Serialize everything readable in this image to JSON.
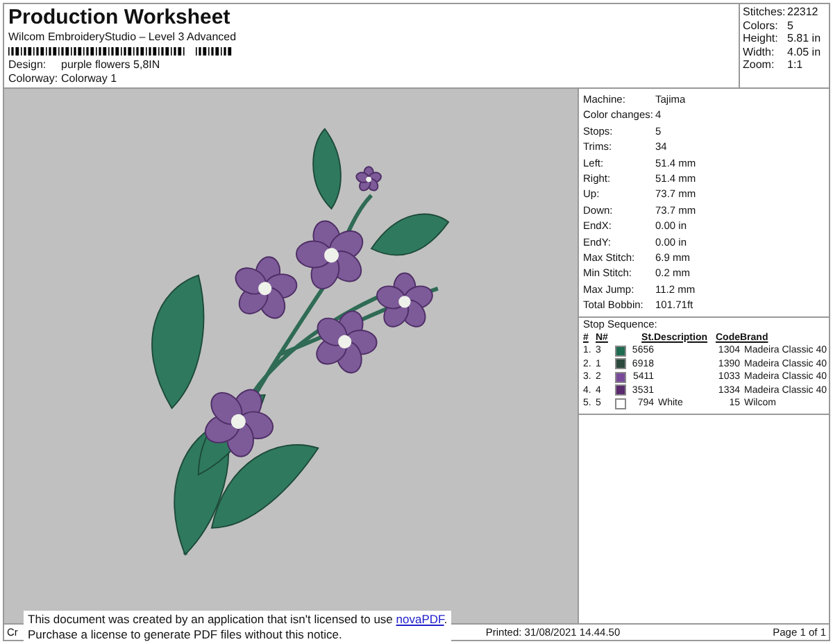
{
  "header": {
    "title": "Production Worksheet",
    "subtitle": "Wilcom EmbroideryStudio – Level 3 Advanced",
    "fields": [
      {
        "label": "Design:",
        "value": "purple flowers 5,8IN"
      },
      {
        "label": "Colorway:",
        "value": "Colorway 1"
      }
    ]
  },
  "summary": [
    {
      "label": "Stitches:",
      "value": "22312"
    },
    {
      "label": "Colors:",
      "value": "5"
    },
    {
      "label": "Height:",
      "value": "5.81 in"
    },
    {
      "label": "Width:",
      "value": "4.05 in"
    },
    {
      "label": "Zoom:",
      "value": "1:1"
    }
  ],
  "machine_info": [
    {
      "label": "Machine:",
      "value": "Tajima"
    },
    {
      "label": "Color changes:",
      "value": "4"
    },
    {
      "label": "Stops:",
      "value": "5"
    },
    {
      "label": "Trims:",
      "value": "34"
    },
    {
      "label": "Left:",
      "value": "51.4 mm"
    },
    {
      "label": "Right:",
      "value": "51.4 mm"
    },
    {
      "label": "Up:",
      "value": "73.7 mm"
    },
    {
      "label": "Down:",
      "value": "73.7 mm"
    },
    {
      "label": "EndX:",
      "value": "0.00 in"
    },
    {
      "label": "EndY:",
      "value": "0.00 in"
    },
    {
      "label": "Max Stitch:",
      "value": "6.9 mm"
    },
    {
      "label": "Min Stitch:",
      "value": "0.2 mm"
    },
    {
      "label": "Max Jump:",
      "value": "11.2 mm"
    },
    {
      "label": "Total Bobbin:",
      "value": "101.71ft"
    }
  ],
  "stop_sequence": {
    "title": "Stop Sequence:",
    "columns": [
      "#",
      "N#",
      "St.",
      "Description",
      "Code",
      "Brand"
    ],
    "rows": [
      {
        "index": "1.",
        "n": "3",
        "color": "#1f6b52",
        "stitches": "5656",
        "description": "",
        "code": "1304",
        "brand": "Madeira Classic 40"
      },
      {
        "index": "2.",
        "n": "1",
        "color": "#2c4a3e",
        "stitches": "6918",
        "description": "",
        "code": "1390",
        "brand": "Madeira Classic 40"
      },
      {
        "index": "3.",
        "n": "2",
        "color": "#7a4a9a",
        "stitches": "5411",
        "description": "",
        "code": "1033",
        "brand": "Madeira Classic 40"
      },
      {
        "index": "4.",
        "n": "4",
        "color": "#5a2a6e",
        "stitches": "3531",
        "description": "",
        "code": "1334",
        "brand": "Madeira Classic 40"
      },
      {
        "index": "5.",
        "n": "5",
        "color": "#ffffff",
        "stitches": "794",
        "description": "White",
        "code": "15",
        "brand": "Wilcom"
      }
    ]
  },
  "footer": {
    "left": "Cr",
    "printed": "Printed: 31/08/2021 14.44.50",
    "page": "Page 1 of 1"
  },
  "notice": {
    "line1": "This document was created by an application that isn't licensed to use",
    "link": "novaPDF",
    "line1_end": ".",
    "line2": "Purchase a license to generate PDF files without this notice."
  }
}
